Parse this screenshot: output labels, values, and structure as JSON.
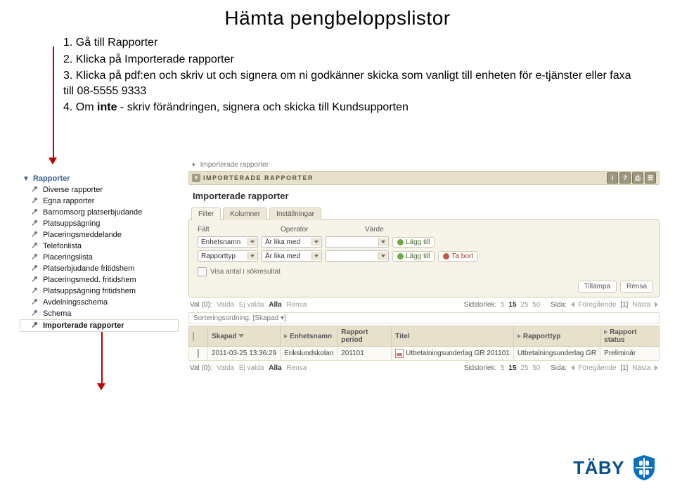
{
  "title": "Hämta pengbeloppslistor",
  "instructions": {
    "step1": "1. Gå till Rapporter",
    "step2": "2. Klicka på Importerade rapporter",
    "step3": "3. Klicka på pdf:en och skriv ut och signera om ni godkänner skicka som vanligt till enheten för e-tjänster eller faxa till 08-5555 9333",
    "step4_a": "4. Om ",
    "step4_b": "inte",
    "step4_c": " - skriv förändringen, signera och skicka till Kundsupporten"
  },
  "sidebar": {
    "header": "Rapporter",
    "items": [
      "Diverse rapporter",
      "Egna rapporter",
      "Barnomsorg platserbjudande",
      "Platsuppsägning",
      "Placeringsmeddelande",
      "Telefonlista",
      "Placeringslista",
      "Platserbjudande fritidshem",
      "Placeringsmedd. fritidshem",
      "Platsuppsägning fritidshem",
      "Avdelningsschema",
      "Schema",
      "Importerade rapporter"
    ]
  },
  "breadcrumb": "Importerade rapporter",
  "section_title": "IMPORTERADE RAPPORTER",
  "panel_title": "Importerade rapporter",
  "tabs": [
    "Filter",
    "Kolumner",
    "Inställningar"
  ],
  "filter": {
    "head_field": "Fält",
    "head_operator": "Operator",
    "head_value": "Värde",
    "row1_field": "Enhetsnamn",
    "row1_op": "Är lika med",
    "row2_field": "Rapporttyp",
    "row2_op": "Är lika med",
    "add": "Lägg till",
    "remove": "Ta bort",
    "show_count": "Visa antal i sökresultat",
    "apply": "Tillämpa",
    "clear": "Rensa"
  },
  "selection": {
    "prefix": "Val (0):",
    "valda": "Valda",
    "ej_valda": "Ej valda",
    "alla": "Alla",
    "rensa": "Rensa",
    "page_size_label": "Sidstorlek:",
    "sizes": [
      "5",
      "15",
      "25",
      "50"
    ],
    "page_label": "Sida:",
    "prev": "Föregående",
    "page_num": "[1]",
    "next": "Nästa"
  },
  "sort_bar_label": "Sorteringsordning:",
  "sort_bar_value": "[Skapad ▾]",
  "table": {
    "cols": [
      "Skapad",
      "Enhetsnamn",
      "Rapport period",
      "Titel",
      "Rapporttyp",
      "Rapport status"
    ],
    "row": {
      "skapad": "2011-03-25 13:36:29",
      "enhet": "Erikslundskolan",
      "period": "201101",
      "titel": "Utbetalningsunderlag GR 201101",
      "typ": "Utbetalningsunderlag GR",
      "status": "Preliminär"
    }
  },
  "logo_text": "TÄBY"
}
